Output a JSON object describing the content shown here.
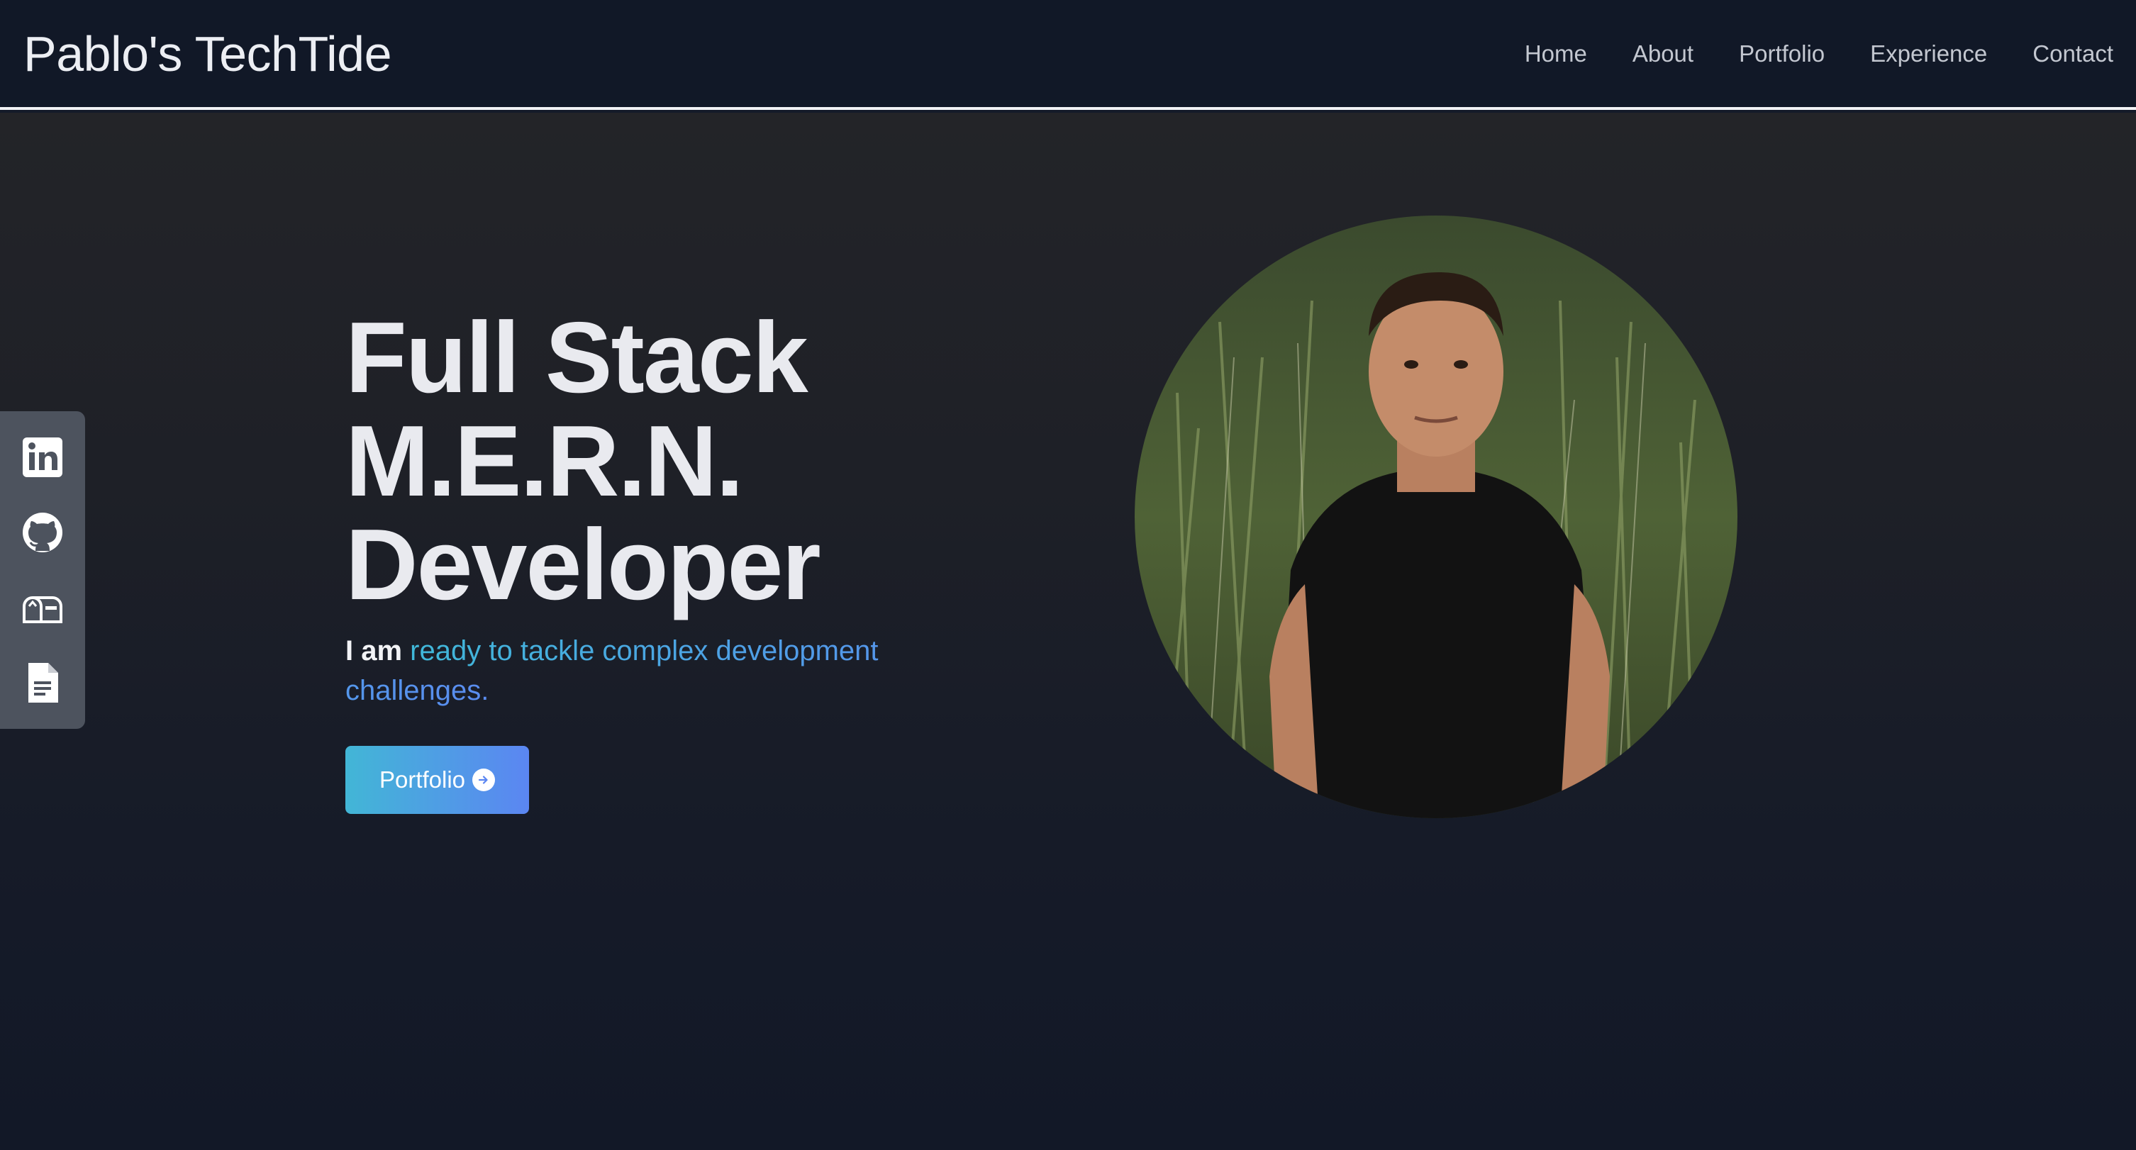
{
  "header": {
    "brand": "Pablo's TechTide",
    "nav": [
      {
        "label": "Home"
      },
      {
        "label": "About"
      },
      {
        "label": "Portfolio"
      },
      {
        "label": "Experience"
      },
      {
        "label": "Contact"
      }
    ]
  },
  "sidebar": {
    "icons": [
      {
        "icon": "linkedin-icon"
      },
      {
        "icon": "github-icon"
      },
      {
        "icon": "mailbox-icon"
      },
      {
        "icon": "resume-document-icon"
      }
    ]
  },
  "hero": {
    "headline": [
      "Full Stack",
      "M.E.R.N.",
      "Developer"
    ],
    "tagline_lead": "I am",
    "tagline_accent": "ready to tackle complex development challenges.",
    "cta_label": "Portfolio",
    "cta_icon": "arrow-right-circle-icon",
    "portrait_alt": "profile-photo"
  },
  "colors": {
    "navbar_bg": "#111827",
    "accent_start": "#40b8d9",
    "accent_end": "#5b86f2",
    "sidebar_bg": "#4d535e"
  }
}
